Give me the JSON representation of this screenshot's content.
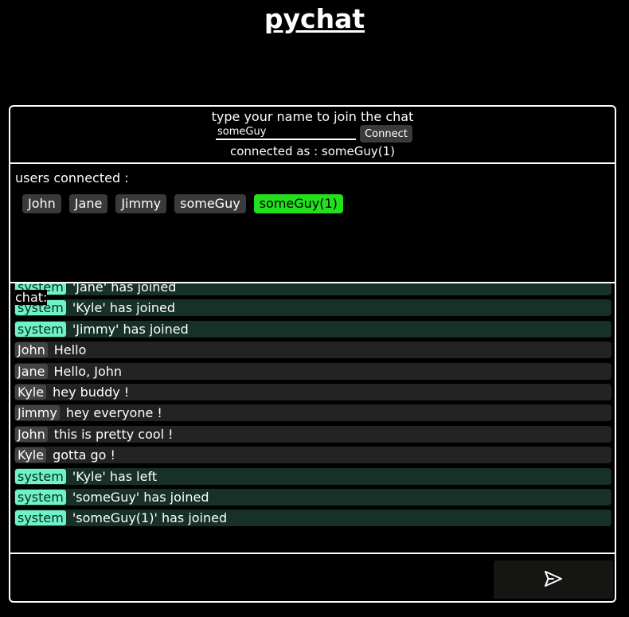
{
  "app": {
    "title": "pychat"
  },
  "join": {
    "prompt": "type your name to join the chat",
    "name_value": "someGuy",
    "connect_label": "Connect",
    "status": "connected as : someGuy(1)"
  },
  "users": {
    "label": "users connected :",
    "list": [
      "John",
      "Jane",
      "Jimmy",
      "someGuy",
      "someGuy(1)"
    ],
    "current_user": "someGuy(1)"
  },
  "chat": {
    "label": "chat:",
    "messages": [
      {
        "sender": "system",
        "text": "'Jane' has joined",
        "type": "system"
      },
      {
        "sender": "system",
        "text": "'Kyle' has joined",
        "type": "system"
      },
      {
        "sender": "system",
        "text": "'Jimmy' has joined",
        "type": "system"
      },
      {
        "sender": "John",
        "text": "Hello",
        "type": "user"
      },
      {
        "sender": "Jane",
        "text": "Hello, John",
        "type": "user"
      },
      {
        "sender": "Kyle",
        "text": "hey buddy !",
        "type": "user"
      },
      {
        "sender": "Jimmy",
        "text": "hey everyone !",
        "type": "user"
      },
      {
        "sender": "John",
        "text": "this is pretty cool !",
        "type": "user"
      },
      {
        "sender": "Kyle",
        "text": "gotta go !",
        "type": "user"
      },
      {
        "sender": "system",
        "text": "'Kyle' has left",
        "type": "system"
      },
      {
        "sender": "system",
        "text": "'someGuy' has joined",
        "type": "system"
      },
      {
        "sender": "system",
        "text": "'someGuy(1)' has joined",
        "type": "system"
      }
    ]
  },
  "send": {
    "message_value": "",
    "icon": "send-icon"
  },
  "colors": {
    "background": "#000000",
    "current_user_chip": "#22e01c",
    "system_tag": "#6ef2c8",
    "system_row": "#173029",
    "user_row": "#232323",
    "user_chip": "#3a3a3a"
  }
}
